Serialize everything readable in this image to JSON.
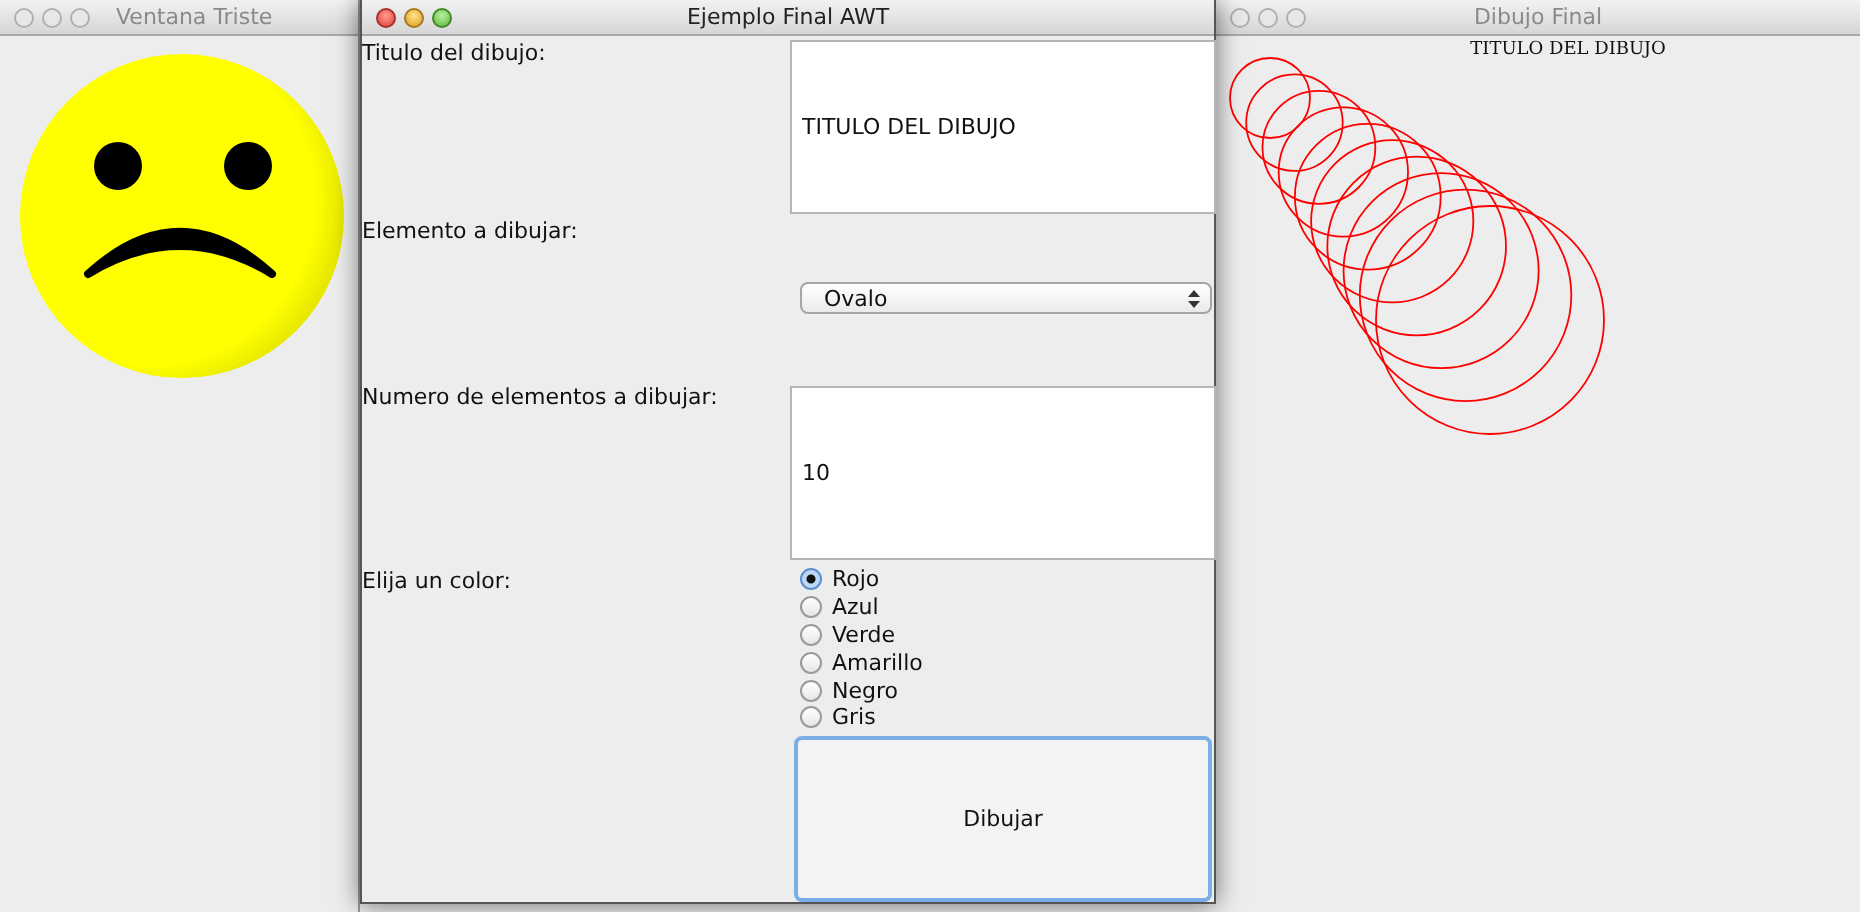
{
  "windows": [
    {
      "kind": "sad-face",
      "title": "Ventana Triste",
      "active": false
    },
    {
      "kind": "form",
      "title": "Ejemplo Final AWT",
      "active": true,
      "form": {
        "title_label": "Titulo del dibujo:",
        "title_value": "TITULO DEL DIBUJO",
        "element_label": "Elemento a dibujar:",
        "element_value": "Ovalo",
        "count_label": "Numero de elementos a dibujar:",
        "count_value": "10",
        "color_label": "Elija un color:",
        "colors": [
          {
            "label": "Rojo",
            "selected": true
          },
          {
            "label": "Azul",
            "selected": false
          },
          {
            "label": "Verde",
            "selected": false
          },
          {
            "label": "Amarillo",
            "selected": false
          },
          {
            "label": "Negro",
            "selected": false
          },
          {
            "label": "Gris",
            "selected": false
          }
        ],
        "button": "Dibujar"
      }
    },
    {
      "kind": "drawing",
      "title": "Dibujo Final",
      "active": false,
      "drawing_title": "TITULO DEL DIBUJO"
    }
  ]
}
